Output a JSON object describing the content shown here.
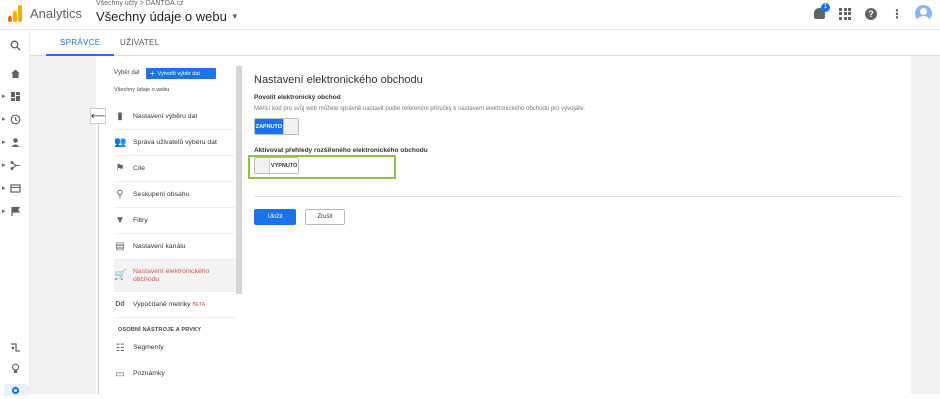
{
  "app": {
    "name": "Analytics"
  },
  "header": {
    "breadcrumb": "Všechny účty > DANTOA.cz",
    "view_title": "Všechny údaje o webu",
    "notification_count": "1"
  },
  "tabs": [
    {
      "label": "SPRÁVCE"
    },
    {
      "label": "UŽIVATEL"
    }
  ],
  "view_selector": {
    "label": "Výběr dat",
    "create_button": "Vytvořit výběr dat",
    "current_view": "Všechny údaje o webu"
  },
  "menu": {
    "items": [
      {
        "label": "Nastavení výběru dat",
        "icon": "document-icon"
      },
      {
        "label": "Správa uživatelů výběru dat",
        "icon": "people-icon"
      },
      {
        "label": "Cíle",
        "icon": "flag-icon"
      },
      {
        "label": "Seskupení obsahu",
        "icon": "person-walk-icon"
      },
      {
        "label": "Filtry",
        "icon": "filter-icon"
      },
      {
        "label": "Nastavení kanálu",
        "icon": "channel-icon"
      },
      {
        "label": "Nastavení elektronického obchodu",
        "icon": "cart-icon"
      },
      {
        "label": "Vypočítané metriky",
        "icon": "dd-icon",
        "badge": "BETA"
      }
    ],
    "section_heading": "OSOBNÍ NÁSTROJE A PRVKY",
    "personal_items": [
      {
        "label": "Segmenty",
        "icon": "segments-icon"
      },
      {
        "label": "Poznámky",
        "icon": "notes-icon"
      }
    ]
  },
  "content": {
    "title": "Nastavení elektronického obchodu",
    "ecommerce": {
      "label": "Povolit elektronický obchod",
      "description": "Měřicí kód pro svůj web můžete správně nastavit podle referenční příručky k nastavení elektronického obchodu pro vývojáře.",
      "toggle_text": "ZAPNUTO",
      "enabled": true
    },
    "enhanced": {
      "label": "Aktivovat přehledy rozšířeného elektronického obchodu",
      "toggle_text": "VYPNUTO",
      "enabled": false
    },
    "save_button": "Uložit",
    "cancel_button": "Zrušit"
  },
  "colors": {
    "accent": "#1a73e8",
    "highlight": "#8bc34a",
    "active_menu_text": "#d9534f"
  }
}
